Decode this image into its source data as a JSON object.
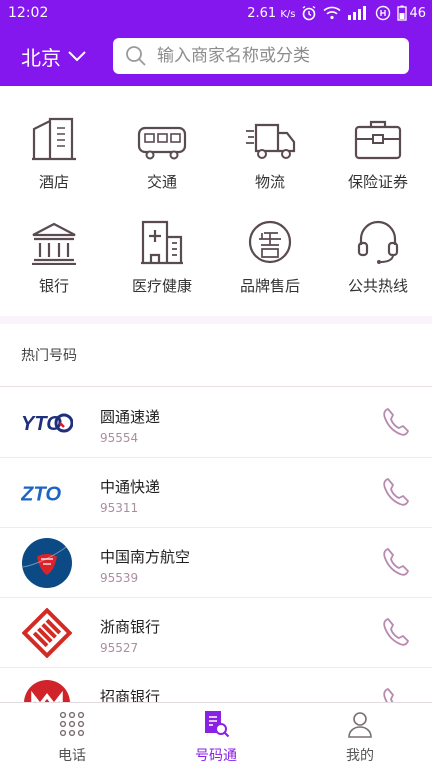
{
  "status": {
    "time": "12:02",
    "speed": "2.61",
    "speed_unit": "K/s",
    "battery": "46"
  },
  "header": {
    "city": "北京",
    "search_placeholder": "输入商家名称或分类"
  },
  "categories": [
    {
      "label": "酒店",
      "icon": "hotel-icon"
    },
    {
      "label": "交通",
      "icon": "bus-icon"
    },
    {
      "label": "物流",
      "icon": "truck-icon"
    },
    {
      "label": "保险证券",
      "icon": "briefcase-icon"
    },
    {
      "label": "银行",
      "icon": "bank-icon"
    },
    {
      "label": "医疗健康",
      "icon": "hospital-icon"
    },
    {
      "label": "品牌售后",
      "icon": "aftersale-icon"
    },
    {
      "label": "公共热线",
      "icon": "headset-icon"
    }
  ],
  "hot_section": {
    "title": "热门号码"
  },
  "hot_numbers": [
    {
      "name": "圆通速递",
      "number": "95554",
      "logo_text": "YTO"
    },
    {
      "name": "中通快递",
      "number": "95311",
      "logo_text": "ZTO"
    },
    {
      "name": "中国南方航空",
      "number": "95539"
    },
    {
      "name": "浙商银行",
      "number": "95527"
    },
    {
      "name": "招商银行",
      "number": ""
    }
  ],
  "tabs": [
    {
      "label": "电话",
      "icon": "dialpad-icon"
    },
    {
      "label": "号码通",
      "icon": "directory-search-icon",
      "active": true
    },
    {
      "label": "我的",
      "icon": "user-icon"
    }
  ],
  "colors": {
    "brand": "#8417ee",
    "active_tab": "#8a22e6",
    "icon_stroke": "#5a4a52",
    "call_icon": "#b98ab0"
  }
}
